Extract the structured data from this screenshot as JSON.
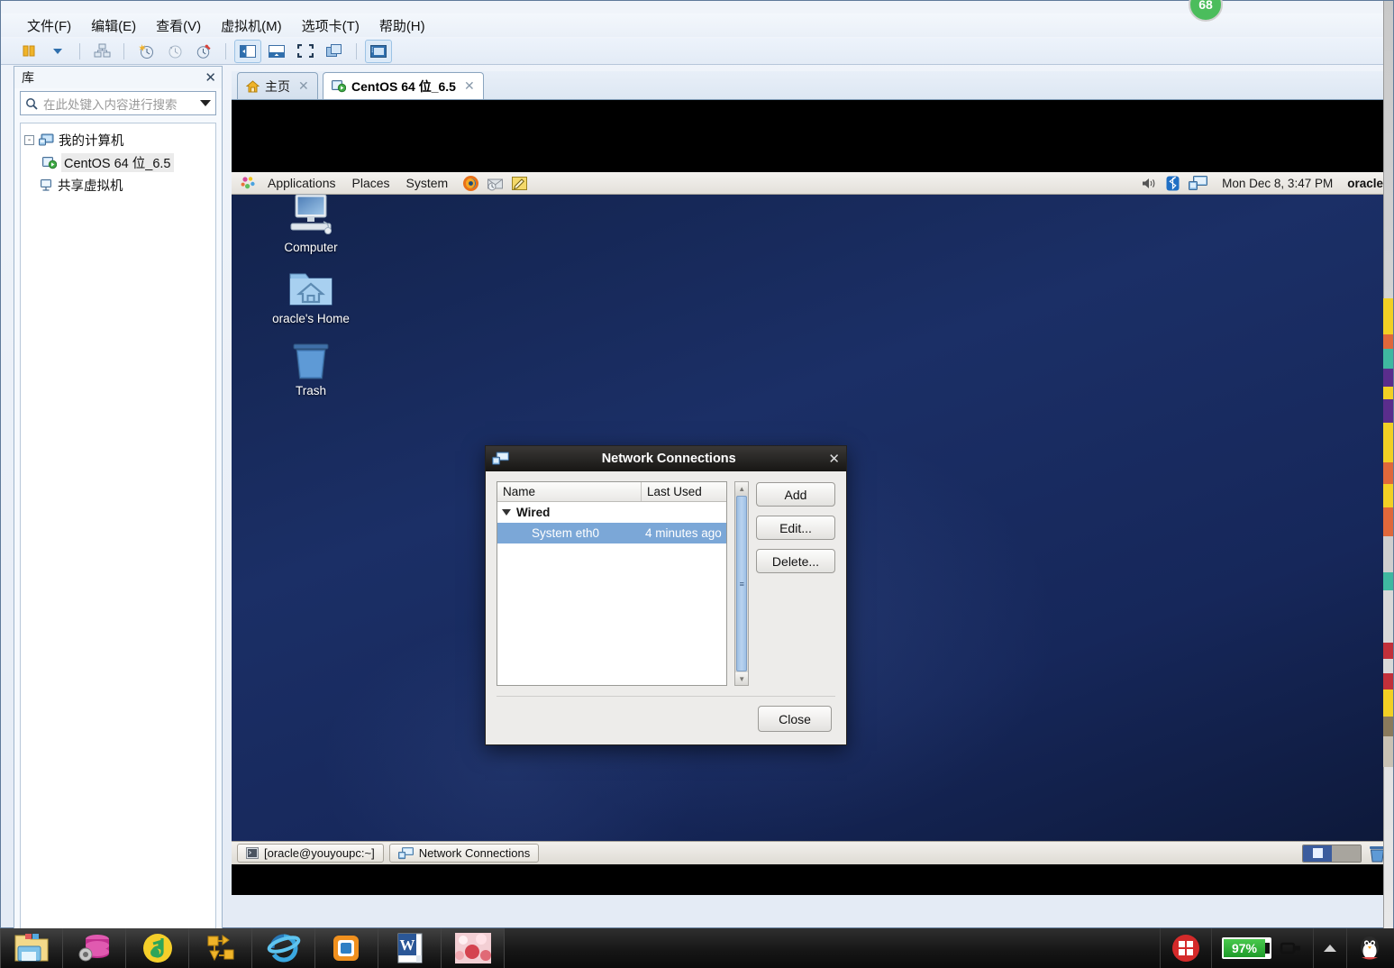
{
  "app": {
    "menu": [
      {
        "label": "文件(F)",
        "name": "menu-file"
      },
      {
        "label": "编辑(E)",
        "name": "menu-edit"
      },
      {
        "label": "查看(V)",
        "name": "menu-view"
      },
      {
        "label": "虚拟机(M)",
        "name": "menu-vm"
      },
      {
        "label": "选项卡(T)",
        "name": "menu-tabs"
      },
      {
        "label": "帮助(H)",
        "name": "menu-help"
      }
    ],
    "badge": "68"
  },
  "library": {
    "title": "库",
    "close_label": "✕",
    "search_placeholder": "在此处键入内容进行搜索",
    "tree": [
      {
        "label": "我的计算机",
        "level": 0,
        "expander": "-",
        "selected": false
      },
      {
        "label": "CentOS 64 位_6.5",
        "level": 1,
        "expander": "",
        "selected": true
      },
      {
        "label": "共享虚拟机",
        "level": 0,
        "expander": "",
        "selected": false
      }
    ]
  },
  "tabs": [
    {
      "label": "主页",
      "active": false,
      "close": "✕"
    },
    {
      "label": "CentOS 64 位_6.5",
      "active": true,
      "close": "✕"
    }
  ],
  "guest": {
    "top_panel": {
      "menus": [
        "Applications",
        "Places",
        "System"
      ],
      "clock": "Mon Dec  8,  3:47 PM",
      "user": "oracle"
    },
    "desktop_icons": [
      {
        "label": "Computer",
        "icon": "computer-icon"
      },
      {
        "label": "oracle's Home",
        "icon": "home-folder-icon"
      },
      {
        "label": "Trash",
        "icon": "trash-icon"
      }
    ],
    "bottom_panel": {
      "tasks": [
        {
          "label": "[oracle@youyoupc:~]",
          "icon": "terminal-icon"
        },
        {
          "label": "Network Connections",
          "icon": "network-icon"
        }
      ]
    }
  },
  "dialog": {
    "title": "Network Connections",
    "close_glyph": "✕",
    "columns": [
      "Name",
      "Last Used"
    ],
    "groups": [
      {
        "name": "Wired",
        "rows": [
          {
            "name": "System eth0",
            "last_used": "4 minutes ago",
            "selected": true
          }
        ]
      }
    ],
    "buttons": {
      "add": "Add",
      "edit": "Edit...",
      "delete": "Delete...",
      "close": "Close"
    }
  },
  "windows_taskbar": {
    "pinned": [
      {
        "name": "file-explorer-icon"
      },
      {
        "name": "database-settings-icon"
      },
      {
        "name": "qq-music-icon"
      },
      {
        "name": "visio-icon"
      },
      {
        "name": "internet-explorer-icon"
      },
      {
        "name": "vmware-icon"
      },
      {
        "name": "word-icon"
      },
      {
        "name": "photo-icon"
      }
    ],
    "battery_percent": "97%",
    "tray": [
      {
        "name": "security-shield-icon"
      },
      {
        "name": "show-hidden-icons-icon"
      },
      {
        "name": "qq-penguin-icon"
      }
    ]
  },
  "colors": {
    "accent": "#3b5c9e",
    "selection": "#7ba7d7",
    "battery_green": "#1f9b2a",
    "badge_green": "#4bbd5c",
    "desktop_blue": "#1b2f66"
  }
}
